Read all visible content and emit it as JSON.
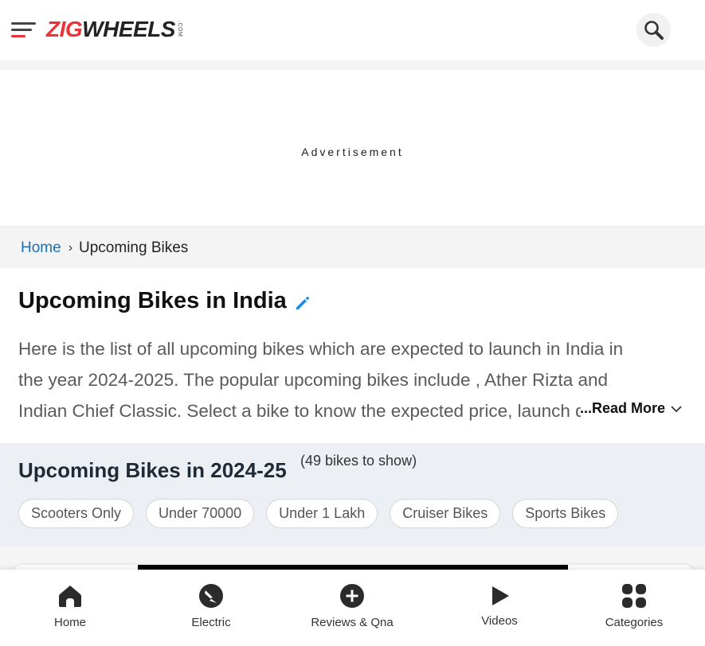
{
  "header": {
    "logo_main": "ZIG",
    "logo_accent": "WHEELS",
    "logo_suffix": ".COM",
    "brand_red": "#e8333b",
    "menu_icon": "hamburger-menu-icon",
    "search_icon": "search-icon"
  },
  "ad": {
    "label": "Advertisement"
  },
  "breadcrumb": {
    "home": "Home",
    "separator": "›",
    "current": "Upcoming Bikes",
    "link_color": "#1a6fb5"
  },
  "page": {
    "title": "Upcoming Bikes in India",
    "edit_icon": "pencil-edit-icon",
    "intro_lines": [
      "Here is the list of all upcoming bikes which are expected to launch in India in",
      "the year 2024-2025. The popular upcoming bikes include , Ather Rizta and",
      "Indian Chief Classic. Select a bike to know the expected price, launch date"
    ],
    "read_more": "...Read More"
  },
  "upcoming": {
    "title": "Upcoming Bikes in 2024-25",
    "count": "(49 bikes to show)",
    "filters": [
      "Scooters Only",
      "Under 70000",
      "Under 1 Lakh",
      "Cruiser Bikes",
      "Sports Bikes"
    ]
  },
  "bottom_nav": {
    "items": [
      {
        "label": "Home",
        "icon": "home-icon"
      },
      {
        "label": "Electric",
        "icon": "electric-bolt-icon"
      },
      {
        "label": "Reviews & Qna",
        "icon": "plus-circle-icon"
      },
      {
        "label": "Videos",
        "icon": "play-icon"
      },
      {
        "label": "Categories",
        "icon": "categories-grid-icon"
      }
    ]
  }
}
